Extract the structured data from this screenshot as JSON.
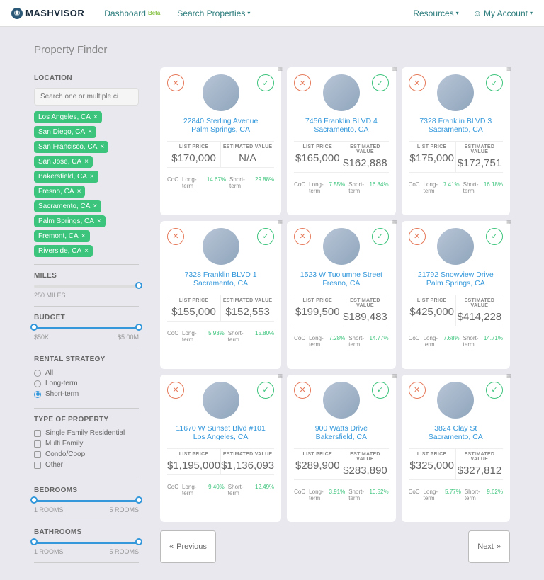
{
  "brand": "MASHVISOR",
  "nav": {
    "dashboard": "Dashboard",
    "beta": "Beta",
    "search": "Search Properties",
    "resources": "Resources",
    "account": "My Account"
  },
  "title": "Property Finder",
  "sidebar": {
    "location": {
      "label": "LOCATION",
      "placeholder": "Search one or multiple ci"
    },
    "chips": [
      "Los Angeles, CA",
      "San Diego, CA",
      "San Francisco, CA",
      "San Jose, CA",
      "Bakersfield, CA",
      "Fresno, CA",
      "Sacramento, CA",
      "Palm Springs, CA",
      "Fremont, CA",
      "Riverside, CA"
    ],
    "miles": {
      "label": "MILES",
      "value": "250 MILES"
    },
    "budget": {
      "label": "BUDGET",
      "min": "$50K",
      "max": "$5.00M"
    },
    "rental": {
      "label": "RENTAL STRATEGY",
      "opts": [
        "All",
        "Long-term",
        "Short-term"
      ],
      "selected": 2
    },
    "type": {
      "label": "TYPE OF PROPERTY",
      "opts": [
        "Single Family Residential",
        "Multi Family",
        "Condo/Coop",
        "Other"
      ]
    },
    "bedrooms": {
      "label": "BEDROOMS",
      "min": "1 ROOMS",
      "max": "5 ROOMS"
    },
    "bathrooms": {
      "label": "BATHROOMS",
      "min": "1 ROOMS",
      "max": "5 ROOMS"
    }
  },
  "cards": [
    {
      "addr1": "22840 Sterling Avenue",
      "addr2": "Palm Springs, CA",
      "list": "$170,000",
      "est": "N/A",
      "lt": "14.67%",
      "st": "29.88%"
    },
    {
      "addr1": "7456 Franklin BLVD 4",
      "addr2": "Sacramento, CA",
      "list": "$165,000",
      "est": "$162,888",
      "lt": "7.55%",
      "st": "16.84%"
    },
    {
      "addr1": "7328 Franklin BLVD 3",
      "addr2": "Sacramento, CA",
      "list": "$175,000",
      "est": "$172,751",
      "lt": "7.41%",
      "st": "16.18%"
    },
    {
      "addr1": "7328 Franklin BLVD 1",
      "addr2": "Sacramento, CA",
      "list": "$155,000",
      "est": "$152,553",
      "lt": "5.93%",
      "st": "15.80%"
    },
    {
      "addr1": "1523 W Tuolumne Street",
      "addr2": "Fresno, CA",
      "list": "$199,500",
      "est": "$189,483",
      "lt": "7.28%",
      "st": "14.77%"
    },
    {
      "addr1": "21792 Snowview Drive",
      "addr2": "Palm Springs, CA",
      "list": "$425,000",
      "est": "$414,228",
      "lt": "7.68%",
      "st": "14.71%"
    },
    {
      "addr1": "11670 W Sunset Blvd #101",
      "addr2": "Los Angeles, CA",
      "list": "$1,195,000",
      "est": "$1,136,093",
      "lt": "9.40%",
      "st": "12.49%"
    },
    {
      "addr1": "900 Watts Drive",
      "addr2": "Bakersfield, CA",
      "list": "$289,900",
      "est": "$283,890",
      "lt": "3.91%",
      "st": "10.52%"
    },
    {
      "addr1": "3824 Clay St",
      "addr2": "Sacramento, CA",
      "list": "$325,000",
      "est": "$327,812",
      "lt": "5.77%",
      "st": "9.62%"
    }
  ],
  "labels": {
    "listPrice": "LIST PRICE",
    "estValue": "ESTIMATED VALUE",
    "coc": "CoC",
    "lt": "Long-term",
    "st": "Short-term"
  },
  "pagination": {
    "prev": "Previous",
    "next": "Next"
  }
}
